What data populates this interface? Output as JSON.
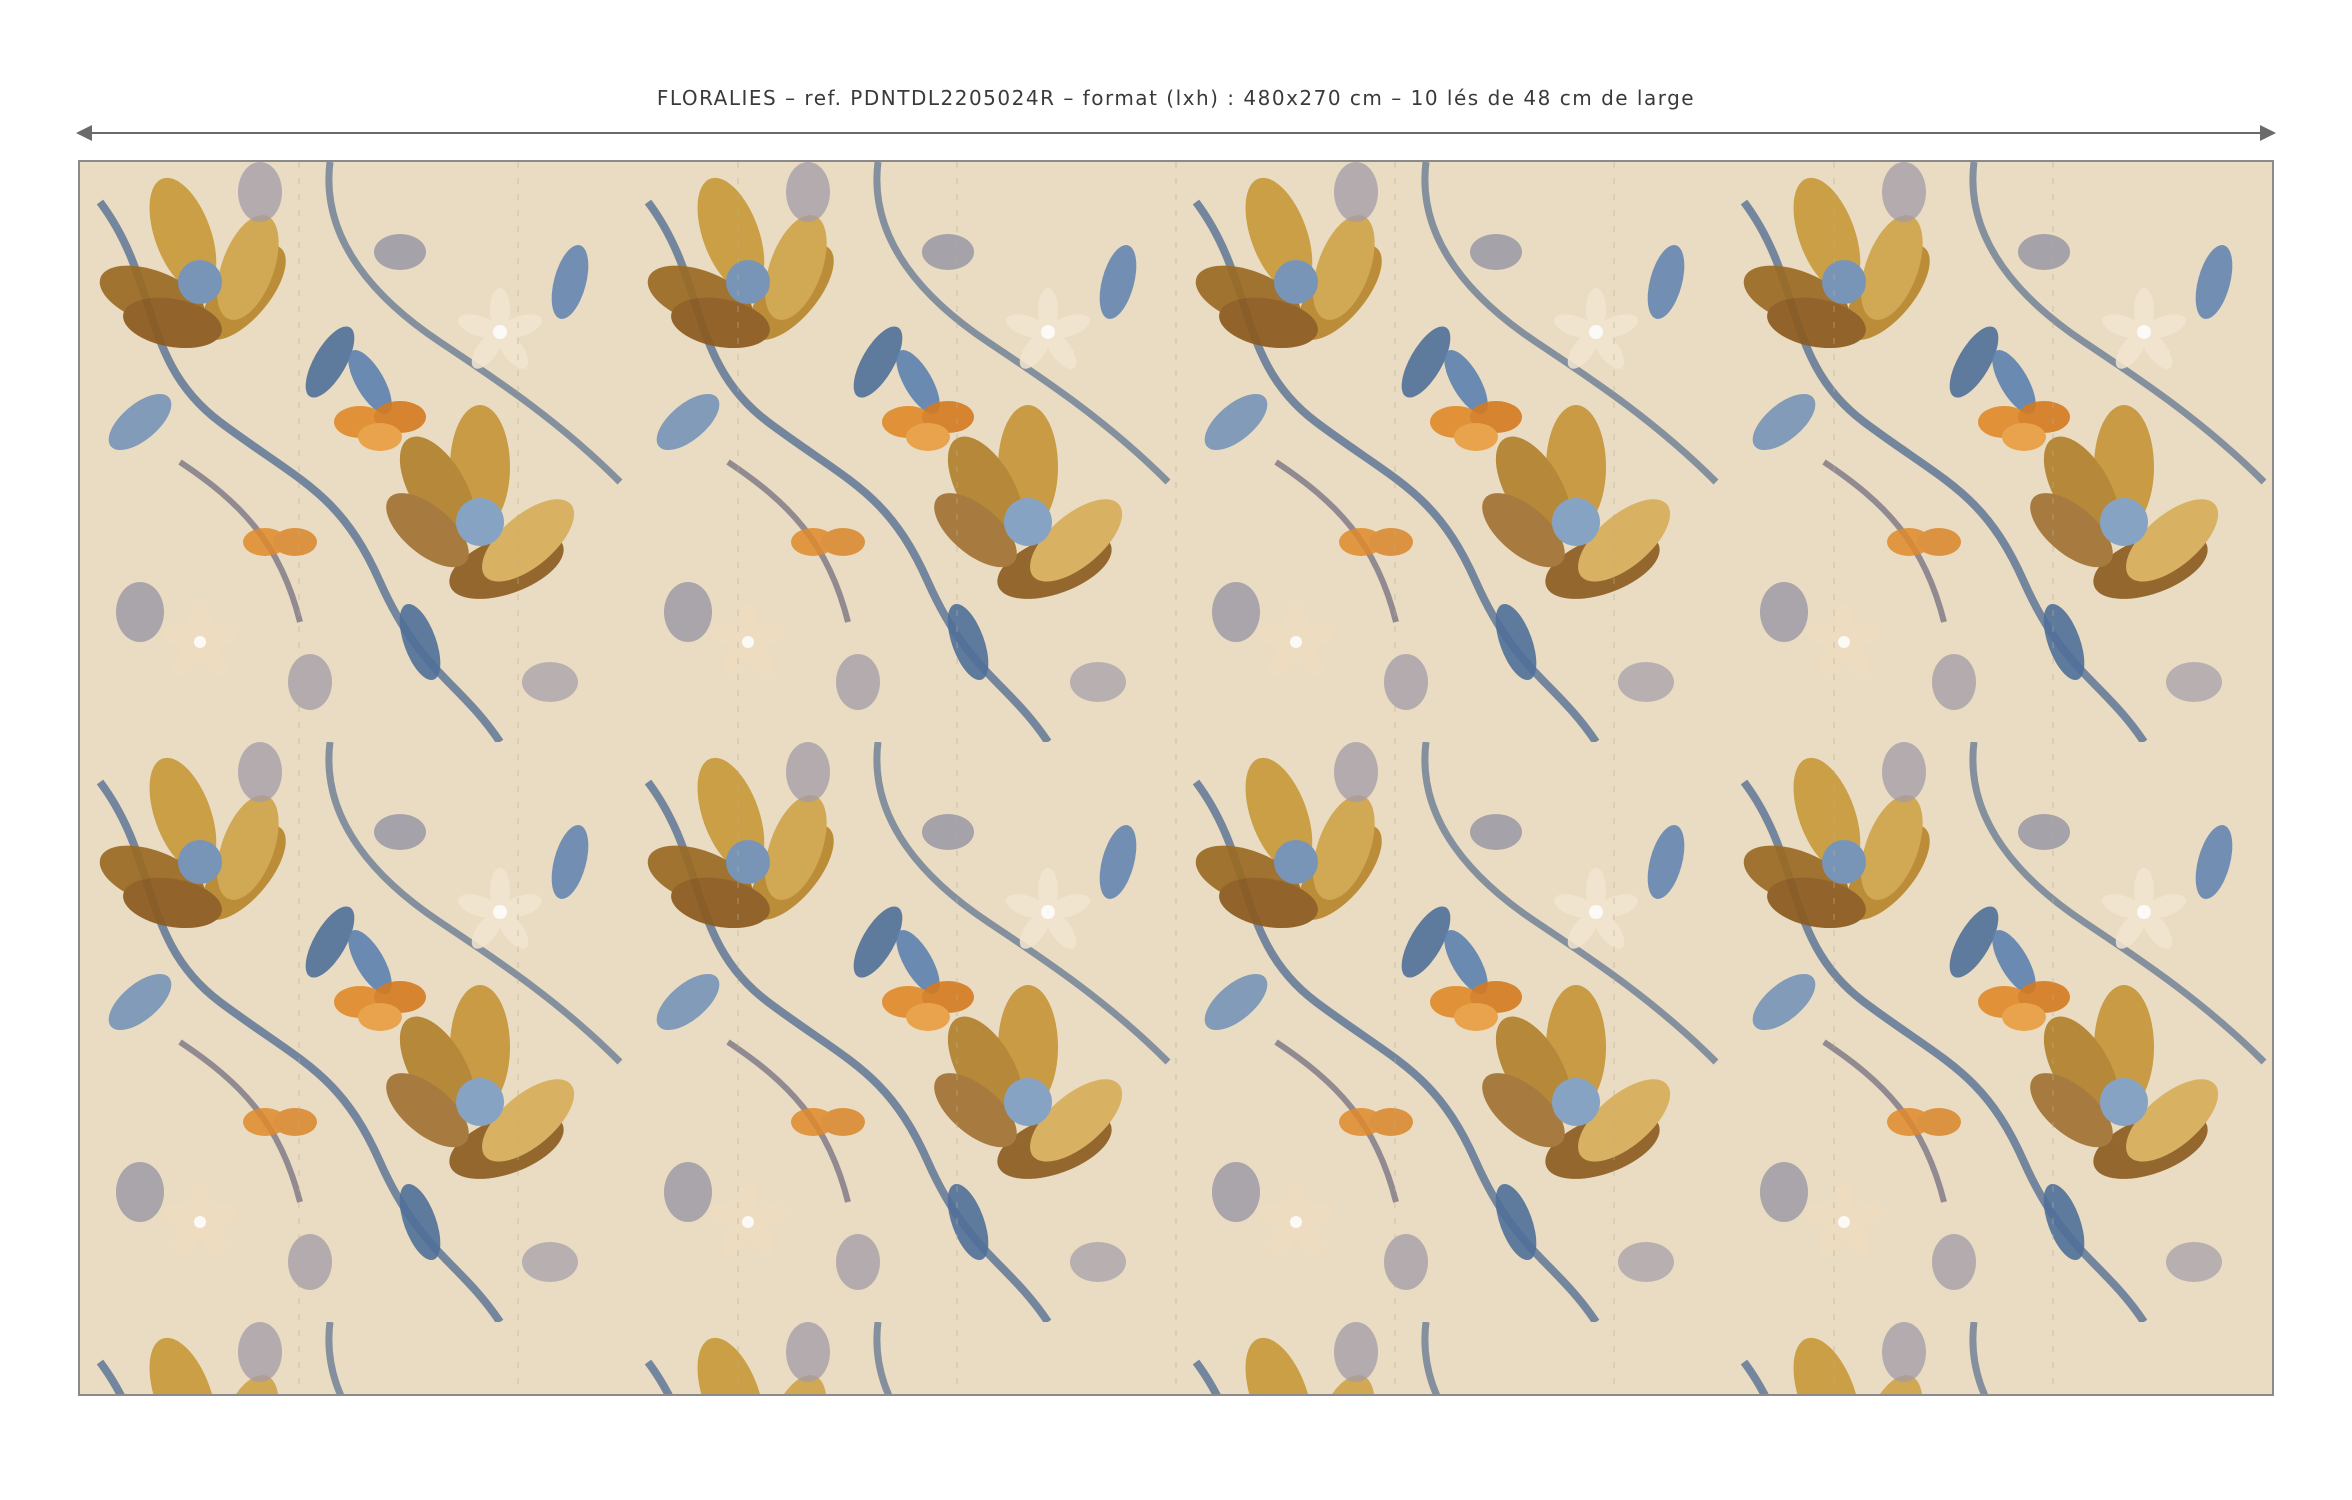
{
  "caption": "FLORALIES – ref. PDNTDL2205024R – format (lxh) : 480x270 cm – 10 lés de 48 cm de large",
  "design": {
    "background_color": "#e9dcc2",
    "palette": [
      "#c89a3a",
      "#8b5a1e",
      "#6f8fb8",
      "#4f6f98",
      "#8f8ea0",
      "#e08a2a",
      "#efe3cf",
      "#a39ba8"
    ],
    "strip_count": 10
  }
}
